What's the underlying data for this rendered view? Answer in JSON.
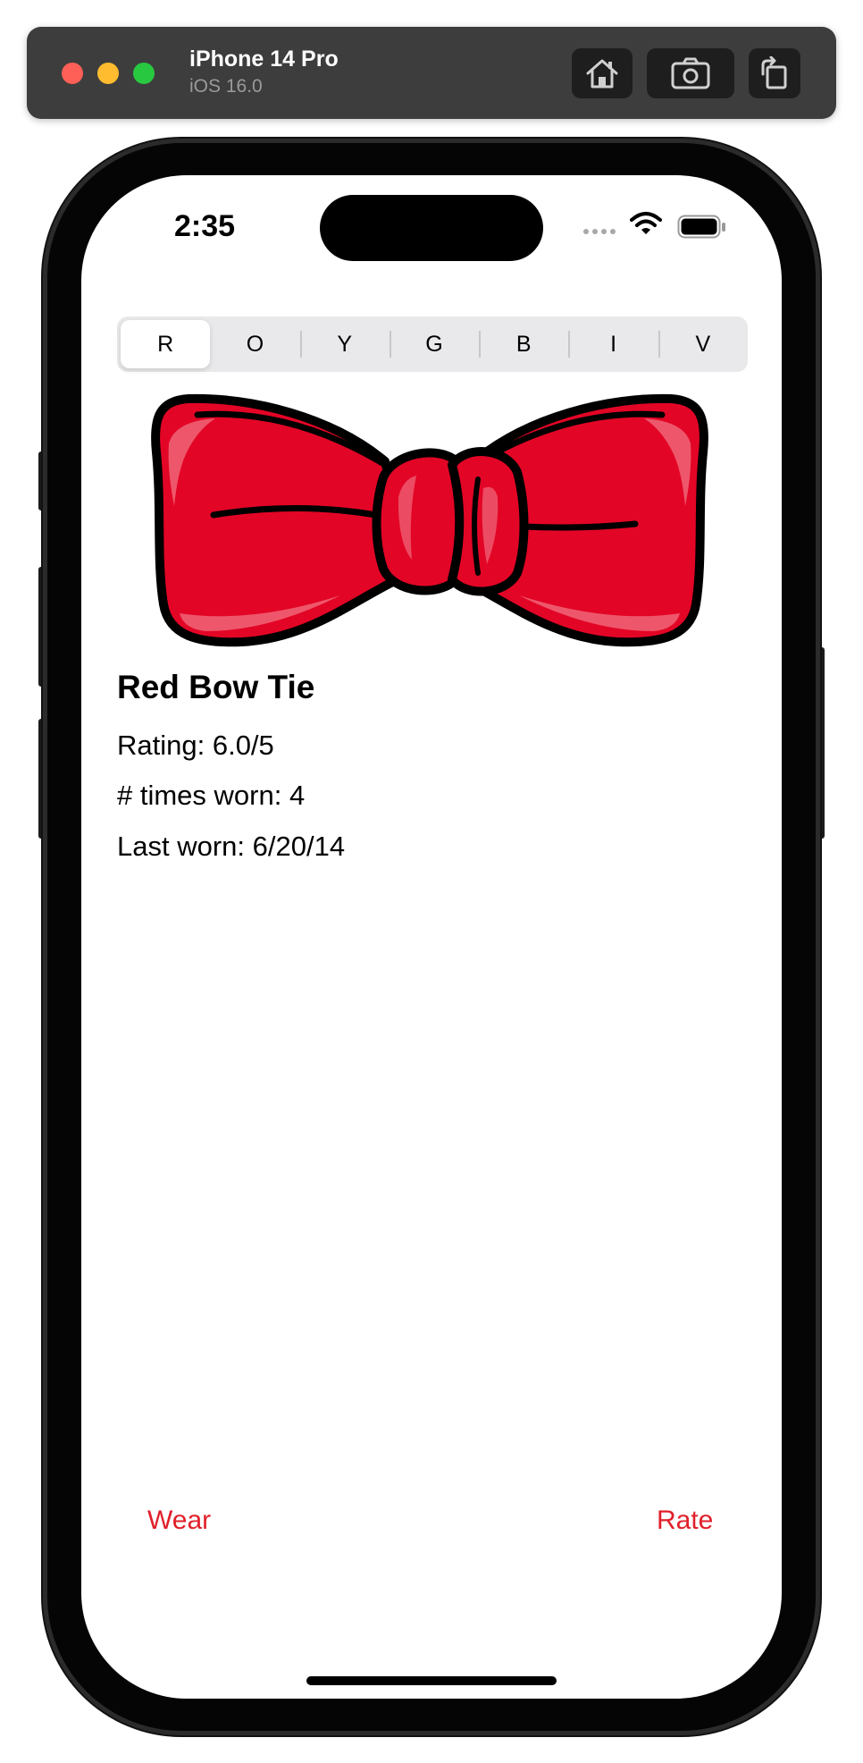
{
  "simulator": {
    "device_name": "iPhone 14 Pro",
    "os_version": "iOS 16.0",
    "buttons": [
      "home-icon",
      "screenshot-icon",
      "rotate-icon"
    ]
  },
  "status_bar": {
    "time": "2:35"
  },
  "segmented": {
    "options": [
      "R",
      "O",
      "Y",
      "G",
      "B",
      "I",
      "V"
    ],
    "selected": "R"
  },
  "item": {
    "name": "Red Bow Tie",
    "rating": "Rating: 6.0/5",
    "times_worn": "# times worn: 4",
    "last_worn": "Last worn: 6/20/14",
    "image": "red-bowtie-image",
    "color": "#e30526"
  },
  "actions": {
    "wear": "Wear",
    "rate": "Rate",
    "tint": "#e0202a"
  }
}
